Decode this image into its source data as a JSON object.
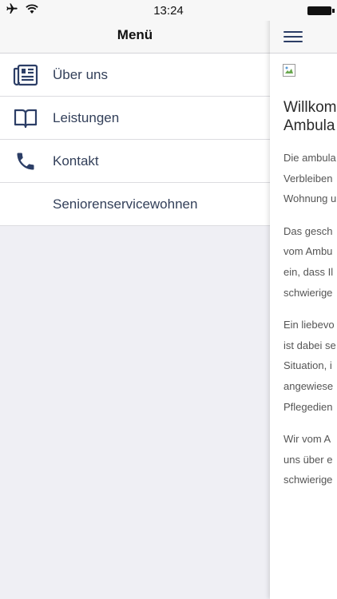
{
  "status_bar": {
    "time": "13:24"
  },
  "menu": {
    "title": "Menü",
    "items": [
      {
        "label": "Über uns",
        "icon": "newspaper-icon"
      },
      {
        "label": "Leistungen",
        "icon": "book-icon"
      },
      {
        "label": "Kontakt",
        "icon": "phone-icon"
      },
      {
        "label": "Seniorenservicewohnen",
        "icon": ""
      }
    ]
  },
  "content": {
    "title_lines": [
      "Willkom",
      "Ambula"
    ],
    "paragraphs": [
      [
        "Die ambula",
        "Verbleiben",
        "Wohnung u"
      ],
      [
        "Das gesch",
        "vom Ambu",
        "ein, dass Il",
        "schwierige"
      ],
      [
        "Ein liebevo",
        "ist dabei se",
        "Situation, i",
        "angewiese",
        "Pflegedien"
      ],
      [
        "Wir vom A",
        "uns über e",
        "schwierige"
      ]
    ]
  },
  "colors": {
    "menu_text": "#33405a",
    "icon_color": "#2c3e66",
    "background": "#efeff4"
  }
}
